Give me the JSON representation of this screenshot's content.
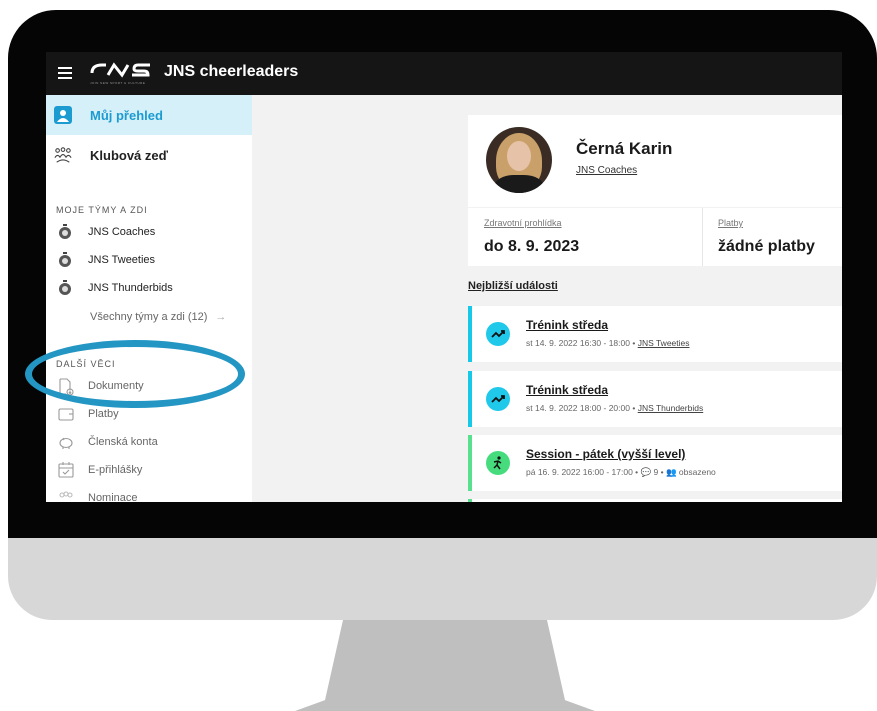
{
  "app": {
    "title": "JNS cheerleaders",
    "logo_text": "JNS",
    "logo_sub": "JOIN NEW SPORT & CULTURE"
  },
  "sidebar": {
    "my_overview": "Můj přehled",
    "club_wall": "Klubová zeď",
    "section_teams": "MOJE TÝMY A ZDI",
    "teams": [
      "JNS Coaches",
      "JNS Tweeties",
      "JNS Thunderbids"
    ],
    "all_teams": "Všechny týmy a zdi (12)",
    "section_more": "DALŠÍ VĚCI",
    "more": [
      "Dokumenty",
      "Platby",
      "Členská konta",
      "E-přihlášky",
      "Nominace"
    ]
  },
  "profile": {
    "name": "Černá Karin",
    "group": "JNS Coaches"
  },
  "stats": [
    {
      "title": "Zdravotní prohlídka",
      "value": "do 8. 9. 2023"
    },
    {
      "title": "Platby",
      "value": "žádné platby"
    }
  ],
  "events_title": "Nejbližší události",
  "events": [
    {
      "title": "Trénink středa",
      "meta": "st 14. 9. 2022 16:30 - 18:00 •",
      "link": "JNS Tweeties"
    },
    {
      "title": "Trénink středa",
      "meta": "st 14. 9. 2022 18:00 - 20:00 •",
      "link": "JNS Thunderbids"
    },
    {
      "title": "Session - pátek (vyšší level)",
      "meta": "pá 16. 9. 2022 16:00 - 17:00 •",
      "comments": "9",
      "status": "obsazeno"
    }
  ],
  "colors": {
    "accent": "#1c9bd0",
    "event_blue": "#17c9e8",
    "event_green": "#58e08e",
    "highlight_ring": "#2396c4"
  }
}
